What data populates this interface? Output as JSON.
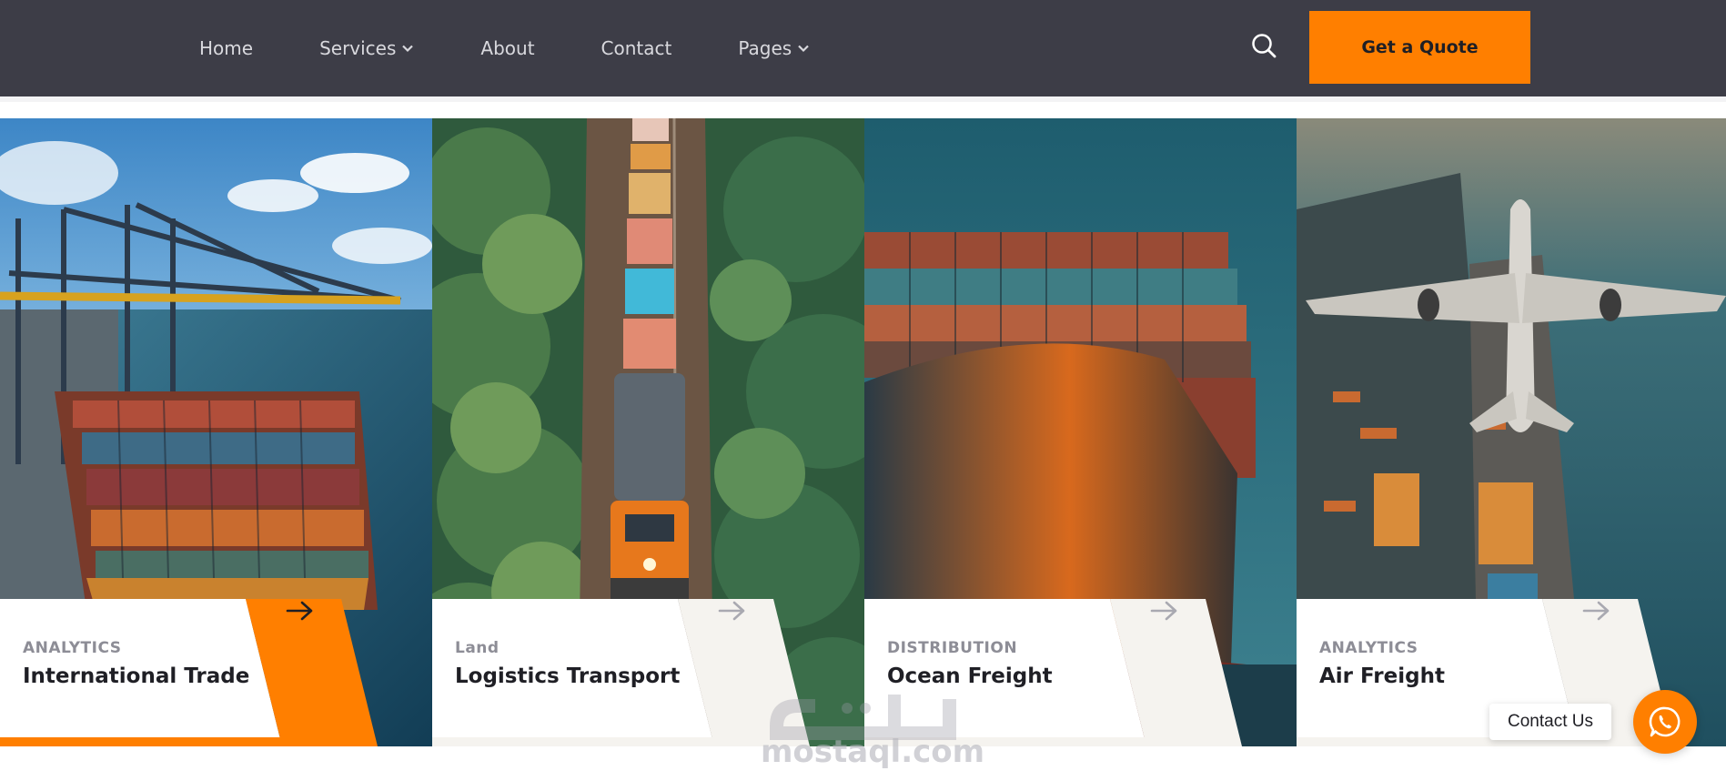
{
  "nav": {
    "items": [
      {
        "label": "Home",
        "has_dropdown": false
      },
      {
        "label": "Services",
        "has_dropdown": true
      },
      {
        "label": "About",
        "has_dropdown": false
      },
      {
        "label": "Contact",
        "has_dropdown": false
      },
      {
        "label": "Pages",
        "has_dropdown": true
      }
    ],
    "search_icon": "search-icon",
    "quote_label": "Get a Quote"
  },
  "cards": [
    {
      "tag": "ANALYTICS",
      "title": "International Trade",
      "image": "container-port-crane-image",
      "active": true
    },
    {
      "tag": "Land",
      "title": "Logistics Transport",
      "image": "freight-train-forest-image",
      "active": false
    },
    {
      "tag": "DISTRIBUTION",
      "title": "Ocean Freight",
      "image": "container-ship-bow-image",
      "active": false
    },
    {
      "tag": "ANALYTICS",
      "title": "Air Freight",
      "image": "airplane-over-port-image",
      "active": false
    }
  ],
  "contact": {
    "label": "Contact Us",
    "icon": "whatsapp-icon"
  },
  "watermark": {
    "text": "mostaql.com"
  },
  "colors": {
    "accent": "#ff7f00",
    "header_bg": "#3d3d47",
    "panel_bg": "#ffffff",
    "panel_inactive_slant": "#f5f3ef"
  }
}
